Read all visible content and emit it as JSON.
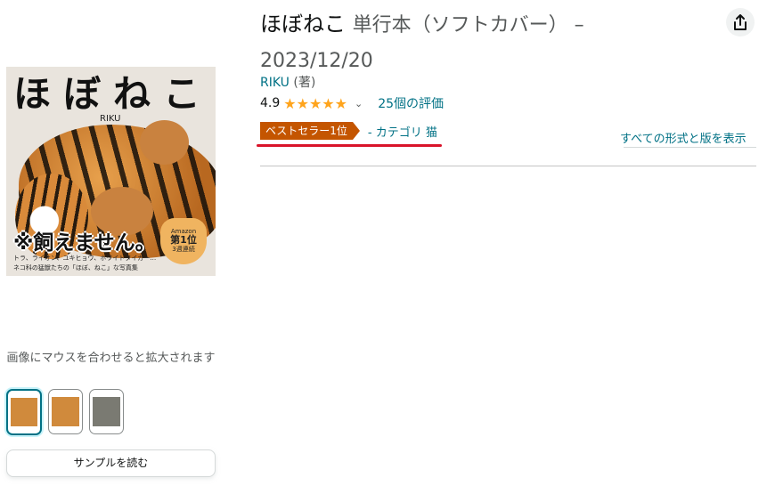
{
  "product": {
    "title": "ほぼねこ",
    "subtitle": "単行本（ソフトカバー） –",
    "date": "2023/12/20",
    "author": "RIKU",
    "author_role": "(著)",
    "rating_value": "4.9",
    "rating_stars": 4.9,
    "rating_count": "25個の評価",
    "bestseller_badge": "ベストセラー1位",
    "bestseller_category": "- カテゴリ 猫",
    "all_formats_link": "すべての形式と版を表示"
  },
  "cover": {
    "title": "ほぼねこ",
    "author": "RIKU",
    "tagline": "※飼えません。",
    "sub1": "トラ、ライオン、ユキヒョウ、ホワイトタイガー…",
    "sub2": "ネコ科の猛獣たちの「ほぼ、ねこ」な写真集",
    "badge_line1": "Amazon",
    "badge_line2": "第1位",
    "badge_line3": "3週連続"
  },
  "image_panel": {
    "hover_text": "画像にマウスを合わせると拡大されます",
    "thumbnails": [
      "cover",
      "cover-alt",
      "inside-page"
    ],
    "sample_button": "サンプルを読む"
  },
  "icons": {
    "share": "share-icon",
    "chevron": "chevron-down-icon"
  },
  "colors": {
    "link": "#007185",
    "star": "#ffa41c",
    "badge": "#c45500",
    "highlight_underline": "#d9142a"
  }
}
